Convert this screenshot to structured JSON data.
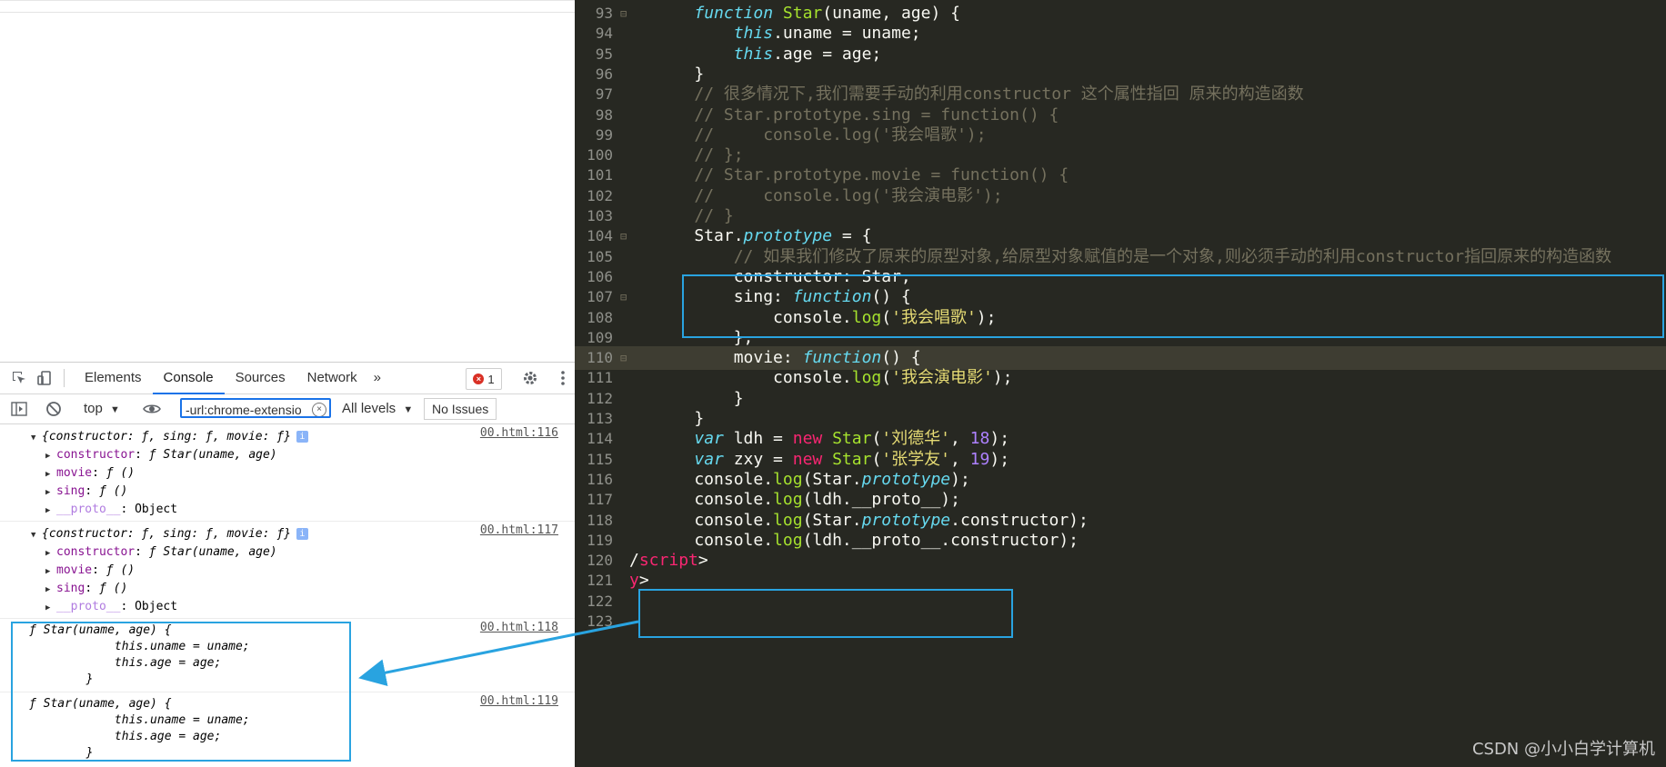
{
  "devtools": {
    "tabs": [
      "Elements",
      "Console",
      "Sources",
      "Network"
    ],
    "more_tabs": "»",
    "error_count": "1",
    "toolbar": {
      "context": "top",
      "filter_value": "-url:chrome-extensio",
      "levels": "All levels",
      "issues": "No Issues"
    },
    "messages": [
      {
        "source": "00.html:116",
        "summary": "{constructor: ƒ, sing: ƒ, movie: ƒ}",
        "props": [
          {
            "key": "constructor",
            "value": "ƒ Star(uname, age)"
          },
          {
            "key": "movie",
            "value": "ƒ ()"
          },
          {
            "key": "sing",
            "value": "ƒ ()"
          },
          {
            "key": "__proto__",
            "value": "Object"
          }
        ]
      },
      {
        "source": "00.html:117",
        "summary": "{constructor: ƒ, sing: ƒ, movie: ƒ}",
        "props": [
          {
            "key": "constructor",
            "value": "ƒ Star(uname, age)"
          },
          {
            "key": "movie",
            "value": "ƒ ()"
          },
          {
            "key": "sing",
            "value": "ƒ ()"
          },
          {
            "key": "__proto__",
            "value": "Object"
          }
        ]
      },
      {
        "source": "00.html:118",
        "lines": [
          "ƒ Star(uname, age) {",
          "            this.uname = uname;",
          "            this.age = age;",
          "        }"
        ]
      },
      {
        "source": "00.html:119",
        "lines": [
          "ƒ Star(uname, age) {",
          "            this.uname = uname;",
          "            this.age = age;",
          "        }"
        ]
      }
    ]
  },
  "editor": {
    "lines": [
      {
        "n": "93",
        "fold": "⊟",
        "code": "    function Star(uname, age) {"
      },
      {
        "n": "94",
        "fold": "",
        "code": "        this.uname = uname;"
      },
      {
        "n": "95",
        "fold": "",
        "code": "        this.age = age;"
      },
      {
        "n": "96",
        "fold": "",
        "code": "    }"
      },
      {
        "n": "97",
        "fold": "",
        "code": "    // 很多情况下,我们需要手动的利用constructor 这个属性指回 原来的构造函数"
      },
      {
        "n": "98",
        "fold": "",
        "code": "    // Star.prototype.sing = function() {"
      },
      {
        "n": "99",
        "fold": "",
        "code": "    //     console.log('我会唱歌');"
      },
      {
        "n": "100",
        "fold": "",
        "code": "    // };"
      },
      {
        "n": "101",
        "fold": "",
        "code": "    // Star.prototype.movie = function() {"
      },
      {
        "n": "102",
        "fold": "",
        "code": "    //     console.log('我会演电影');"
      },
      {
        "n": "103",
        "fold": "",
        "code": "    // }"
      },
      {
        "n": "104",
        "fold": "⊟",
        "code": "    Star.prototype = {"
      },
      {
        "n": "105",
        "fold": "",
        "code": "        // 如果我们修改了原来的原型对象,给原型对象赋值的是一个对象,则必须手动的利用constructor指回原来的构造函数"
      },
      {
        "n": "106",
        "fold": "",
        "code": "        constructor: Star,"
      },
      {
        "n": "107",
        "fold": "⊟",
        "code": "        sing: function() {"
      },
      {
        "n": "108",
        "fold": "",
        "code": "            console.log('我会唱歌');"
      },
      {
        "n": "109",
        "fold": "",
        "code": "        },"
      },
      {
        "n": "110",
        "fold": "⊟",
        "code": "        movie: function() {"
      },
      {
        "n": "111",
        "fold": "",
        "code": "            console.log('我会演电影');"
      },
      {
        "n": "112",
        "fold": "",
        "code": "        }"
      },
      {
        "n": "113",
        "fold": "",
        "code": "    }"
      },
      {
        "n": "114",
        "fold": "",
        "code": "    var ldh = new Star('刘德华', 18);"
      },
      {
        "n": "115",
        "fold": "",
        "code": "    var zxy = new Star('张学友', 19);"
      },
      {
        "n": "116",
        "fold": "",
        "code": "    console.log(Star.prototype);"
      },
      {
        "n": "117",
        "fold": "",
        "code": "    console.log(ldh.__proto__);"
      },
      {
        "n": "118",
        "fold": "",
        "code": "    console.log(Star.prototype.constructor);"
      },
      {
        "n": "119",
        "fold": "",
        "code": "    console.log(ldh.__proto__.constructor);"
      },
      {
        "n": "120",
        "fold": "",
        "code": "/script>"
      },
      {
        "n": "121",
        "fold": "",
        "code": "y>"
      },
      {
        "n": "122",
        "fold": "",
        "code": ""
      },
      {
        "n": "123",
        "fold": "",
        "code": ""
      }
    ],
    "highlighted_line": "110"
  },
  "watermark": "CSDN @小小白学计算机",
  "colors": {
    "annotation_box": "#29a3e0",
    "editor_bg": "#272822",
    "active_tab": "#1a73e8"
  }
}
